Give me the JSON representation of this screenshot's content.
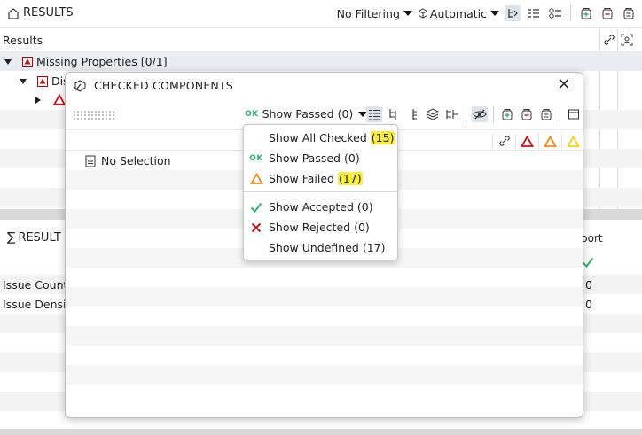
{
  "app": {
    "title": "RESULTS",
    "filtering_label": "No Filtering",
    "automatic_label": "Automatic"
  },
  "results_panel": {
    "header_label": "Results",
    "tree": [
      {
        "label": "Missing Properties [0/1]"
      },
      {
        "label": "Dis"
      }
    ]
  },
  "summary": {
    "title": "RESULT",
    "column_label": "port",
    "rows": [
      {
        "label": "Issue Count",
        "value": "0"
      },
      {
        "label": "Issue Densit",
        "value": "0"
      }
    ]
  },
  "dialog": {
    "title": "CHECKED COMPONENTS",
    "filter": {
      "badge": "OK",
      "label": "Show Passed (0)"
    },
    "empty_text": "No Selection"
  },
  "menu": {
    "items": [
      {
        "label": "Show All Checked",
        "count": "(15)"
      },
      {
        "label": "Show Passed",
        "count": "(0)"
      },
      {
        "label": "Show Failed",
        "count": "(17)"
      },
      {
        "label": "Show Accepted",
        "count": "(0)"
      },
      {
        "label": "Show Rejected",
        "count": "(0)"
      },
      {
        "label": "Show Undefined",
        "count": "(17)"
      }
    ],
    "ok_badge": "OK"
  },
  "colors": {
    "error_red": "#cc1111",
    "warning_orange": "#f08a1c",
    "warning_yellow": "#f2d31b",
    "pass_green": "#2fb56b",
    "highlight_yellow": "#f9ee3a",
    "accent_blue_gray": "#3f5468"
  }
}
